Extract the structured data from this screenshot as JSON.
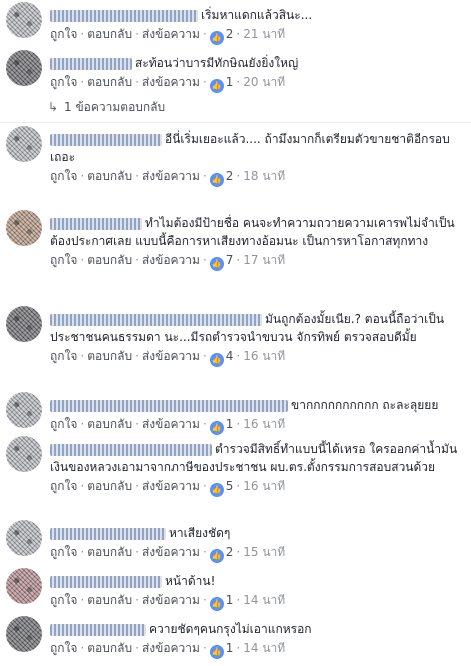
{
  "actions": {
    "like": "ถูกใจ",
    "reply": "ตอบกลับ",
    "message": "ส่งข้อความ",
    "sep": "·"
  },
  "like_icon": "thumbs-up-icon",
  "colors": {
    "like_blue": "#5890ff",
    "link_gray": "#4b4f56",
    "meta_gray": "#90949c"
  },
  "comments": [
    {
      "text": "เริ่มหาแดกแล้วสินะ...",
      "likes": "2",
      "time": "21 นาที"
    },
    {
      "text": "สะท้อนว่าบารมีทักษิณยังยิ่งใหญ่",
      "likes": "1",
      "time": "20 นาที"
    },
    {
      "text": "อีนี่เริ่มเยอะแล้ว.... ถ้ามึงมากก็เตรียมตัวขายชาติอีกรอบเถอะ",
      "likes": "2",
      "time": "18 นาที"
    },
    {
      "text": "ทำไมต้องมีป้ายชื่อ คนจะทำความถวายความเคารพไม่จำเป็นต้องประกาศเลย แบบนี้คือการหาเสียงทางอ้อมนะ เป็นการหาโอกาสทุกทาง",
      "likes": "7",
      "time": "17 นาที"
    },
    {
      "text": "มันถูกต้องมั้ยเนีย.? ตอนนี้ถือว่าเป็นประชาชนคนธรรมดา นะ...มีรถตำรวจนำขบวน จักรทิพย์ ตรวจสอบดีมั้ย",
      "likes": "4",
      "time": "16 นาที"
    },
    {
      "text": "ขากกกกกกกกกก ถะละลุยยย",
      "likes": "1",
      "time": "16 นาที"
    },
    {
      "text": "ตำรวจมีสิทธิ์ทำแบบนี้ได้เหรอ ใครออกค่าน้ำมัน เงินของหลวงเอามาจากภาษีของประชาชน ผบ.ตร.ตั้งกรรมการสอบสวนด้วย",
      "likes": "5",
      "time": "16 นาที"
    },
    {
      "text": "หาเสียงชัดๆ",
      "likes": "2",
      "time": "15 นาที"
    },
    {
      "text": "หน้าด้าน!",
      "likes": "1",
      "time": "14 นาที"
    },
    {
      "text": "ควายชัดๆคนกรุงไม่เอาแกหรอก",
      "likes": "1",
      "time": "14 นาที"
    }
  ],
  "replies": {
    "label": "1 ข้อความตอบกลับ"
  }
}
